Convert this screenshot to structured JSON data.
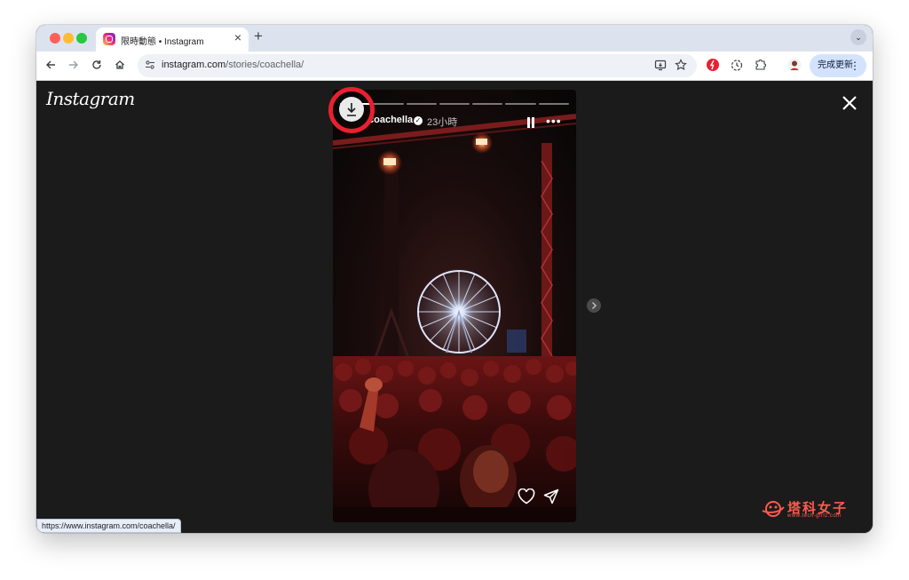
{
  "browser": {
    "tab_title": "限時動態 • Instagram",
    "tab_close": "×",
    "new_tab": "+",
    "tab_menu": "⌄",
    "url_host": "instagram.com",
    "url_path": "/stories/coachella/",
    "update_label": "完成更新",
    "status_url": "https://www.instagram.com/coachella/",
    "traffic_colors": {
      "close": "#ff5f57",
      "minimize": "#febc2e",
      "maximize": "#28c840"
    },
    "icons": {
      "back": "back-arrow-icon",
      "forward": "forward-arrow-icon",
      "reload": "reload-icon",
      "home": "home-icon",
      "site_info": "tune-icon",
      "cast": "install-icon",
      "bookmark": "star-icon",
      "ext1": "red-extension-icon",
      "ext2": "timer-extension-icon",
      "extensions": "puzzle-icon",
      "profile": "avatar-icon"
    }
  },
  "instagram": {
    "logo": "Instagram",
    "story": {
      "username": "coachella",
      "time": "23小時",
      "progress_segments": 7,
      "progress_done": 1
    }
  },
  "watermark": {
    "text": "塔科女子",
    "subtext": "www.tech-girlz.com",
    "color": "#ff5a4e"
  },
  "highlight_color": "#e8202f"
}
